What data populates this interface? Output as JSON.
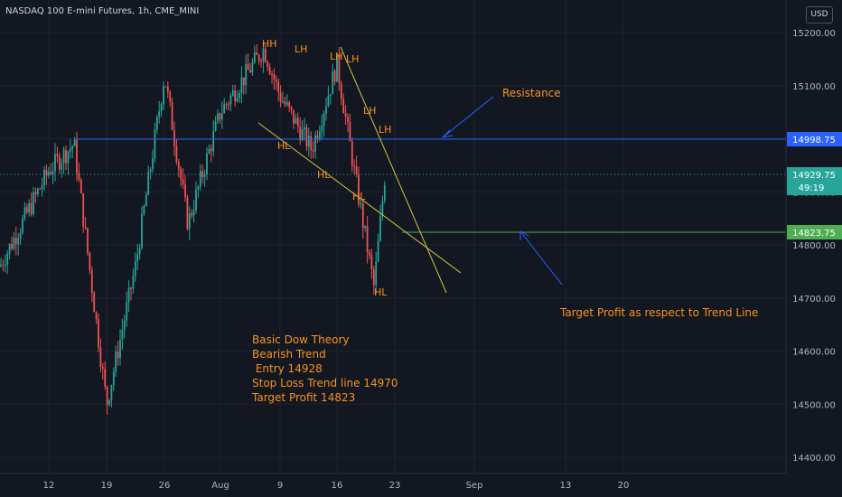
{
  "header": {
    "title": "NASDAQ 100 E-mini Futures, 1h, CME_MINI",
    "currency_button": "USD"
  },
  "colors": {
    "background": "#131722",
    "grid": "#1e222d",
    "up": "#26a69a",
    "down": "#ef5350",
    "annotation": "#f7931a",
    "resistance": "#2962ff",
    "target": "#4caf50",
    "trendline": "#d4c43c",
    "arrow": "#2962ff",
    "axis_text": "#b2b5be"
  },
  "price_axis": {
    "min": 14370,
    "max": 15230,
    "ticks": [
      14400,
      14500,
      14600,
      14700,
      14800,
      14900,
      15000,
      15100,
      15200
    ],
    "tick_labels": [
      "14400.00",
      "14500.00",
      "14600.00",
      "14700.00",
      "14800.00",
      "14900.00",
      "15000.00",
      "15100.00",
      "15200.00"
    ]
  },
  "time_axis": {
    "labels": [
      "12",
      "19",
      "26",
      "Aug",
      "9",
      "16",
      "23",
      "Sep",
      "13",
      "20"
    ],
    "gridlines": true
  },
  "price_tags": {
    "resistance": "14998.75",
    "current": "14929.75",
    "countdown": "49:19",
    "target": "14823.75"
  },
  "annotations": {
    "swing_labels": [
      "HH",
      "LH",
      "LH",
      "LH",
      "LH",
      "LH",
      "HL",
      "HL",
      "HL",
      "HL"
    ],
    "resistance_text": "Resistance",
    "target_text": "Target Profit as respect to Trend Line",
    "strategy_lines": [
      "Basic Dow Theory",
      "Bearish Trend",
      " Entry 14928",
      "Stop Loss Trend line 14970",
      "Target Profit 14823"
    ]
  },
  "chart_data": {
    "type": "candlestick",
    "title": "NASDAQ 100 E-mini Futures, 1h, CME_MINI",
    "x_ticks": [
      "12",
      "19",
      "26",
      "Aug",
      "9",
      "16",
      "23",
      "Sep",
      "13",
      "20"
    ],
    "ylim": [
      14370,
      15230
    ],
    "grid": true,
    "approx_close_path": [
      {
        "x": "start",
        "y": 14760
      },
      {
        "x": "12",
        "y": 14940
      },
      {
        "x": "15",
        "y": 14990
      },
      {
        "x": "19",
        "y": 14500
      },
      {
        "x": "22",
        "y": 14760
      },
      {
        "x": "26",
        "y": 15120
      },
      {
        "x": "28",
        "y": 14840
      },
      {
        "x": "Aug",
        "y": 15050
      },
      {
        "x": "6",
        "y": 15170
      },
      {
        "x": "9",
        "y": 15080
      },
      {
        "x": "12",
        "y": 14980
      },
      {
        "x": "16",
        "y": 15140
      },
      {
        "x": "18",
        "y": 14940
      },
      {
        "x": "19",
        "y": 14720
      },
      {
        "x": "20",
        "y": 14930
      }
    ],
    "horizontal_lines": [
      {
        "label": "Resistance",
        "value": 14998.75
      },
      {
        "label": "Target Profit",
        "value": 14823.75
      }
    ],
    "current_price": 14929.75,
    "swing_points": [
      {
        "label": "HH",
        "price": 15180
      },
      {
        "label": "LH",
        "price": 15170
      },
      {
        "label": "LH",
        "price": 15150
      },
      {
        "label": "LH",
        "price": 15140
      },
      {
        "label": "LH",
        "price": 15070
      },
      {
        "label": "LH",
        "price": 15030
      },
      {
        "label": "HL",
        "price": 14960
      },
      {
        "label": "HL",
        "price": 14900
      },
      {
        "label": "HL",
        "price": 14850
      },
      {
        "label": "HL",
        "price": 14720
      }
    ]
  }
}
